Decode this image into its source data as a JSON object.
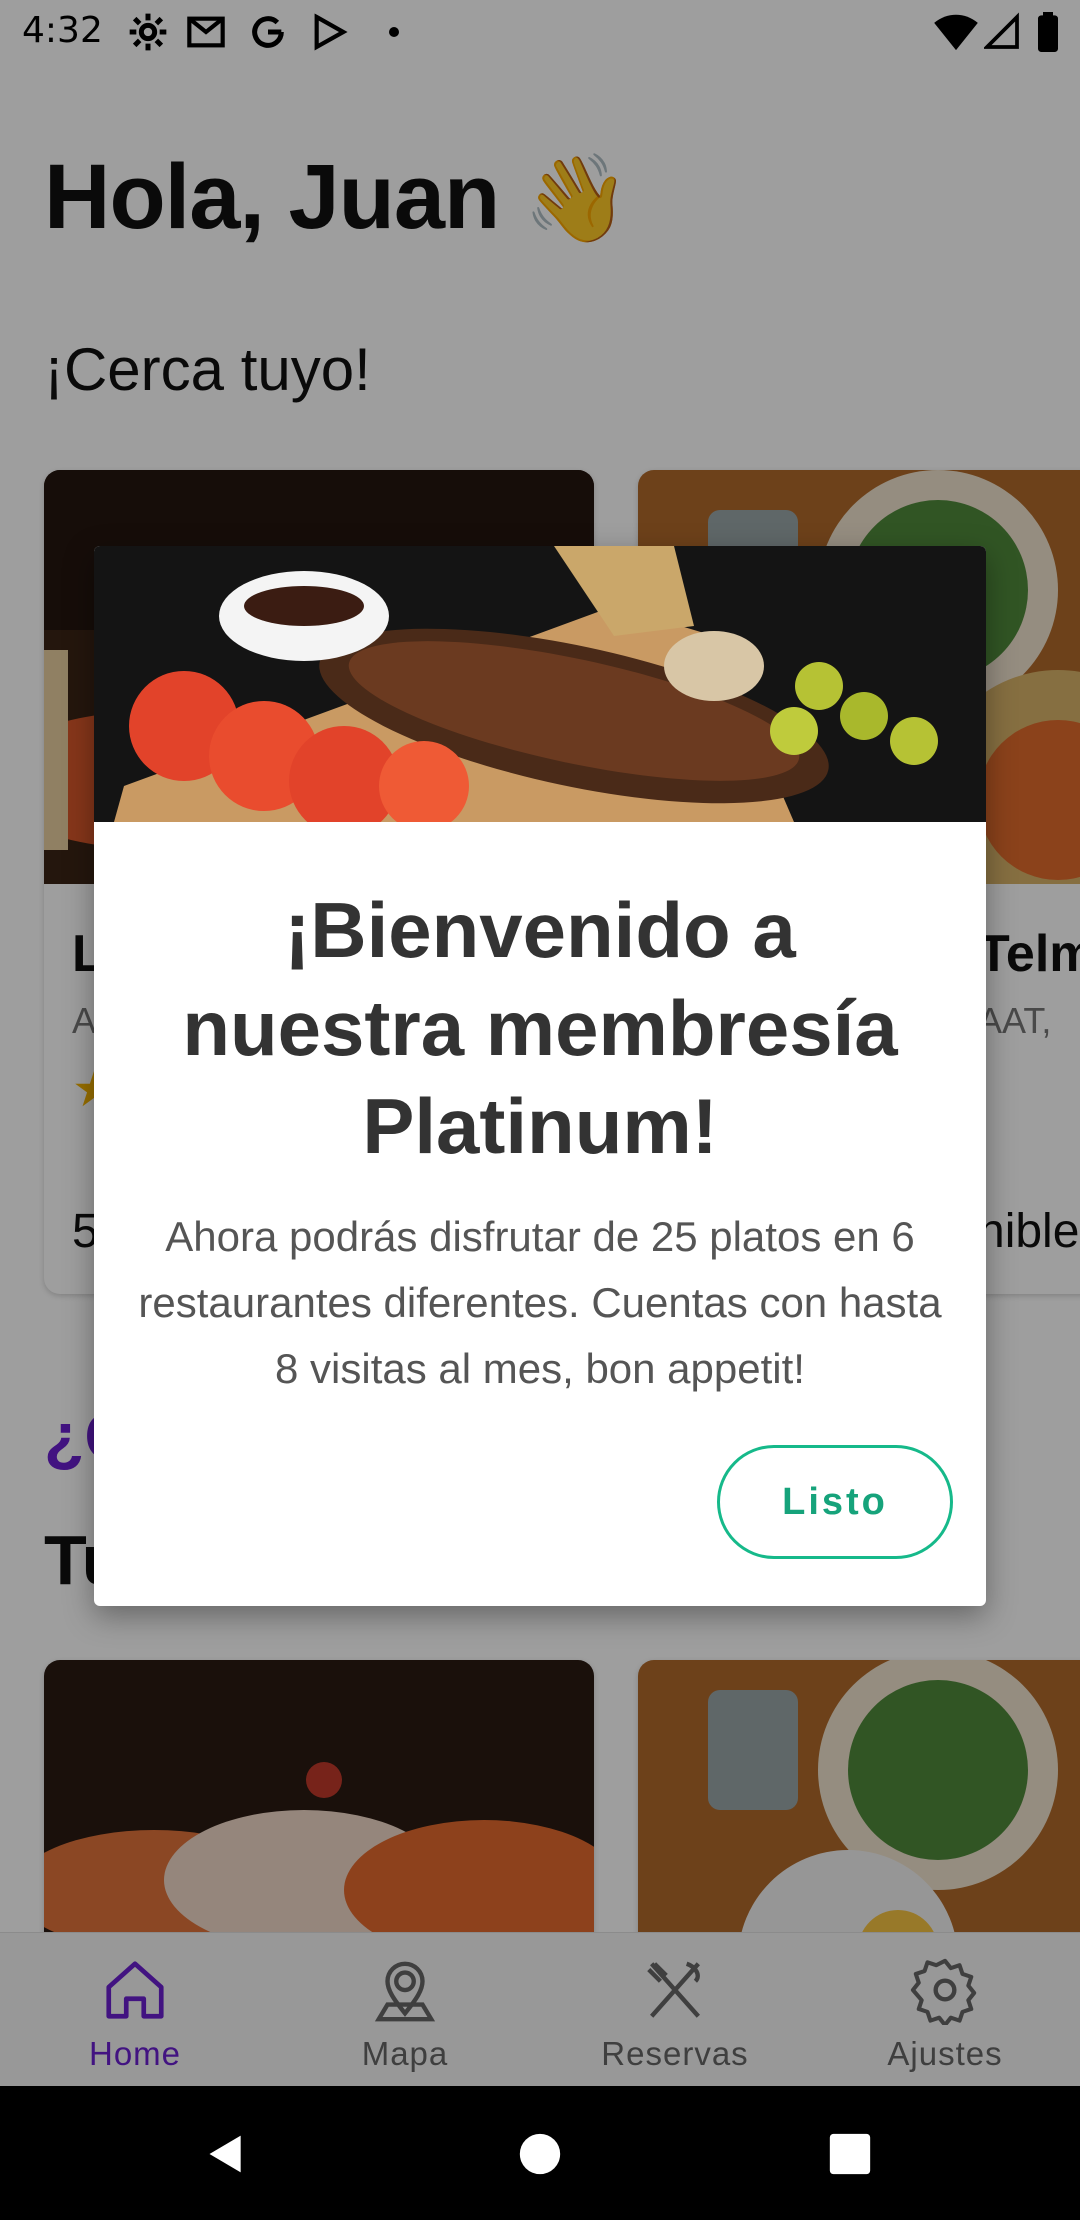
{
  "status_bar": {
    "time": "4:32"
  },
  "header": {
    "greeting": "Hola, Juan",
    "greeting_emoji": "👋"
  },
  "nearby": {
    "title": "¡Cerca tuyo!",
    "cards": [
      {
        "name": "L",
        "subtitle": "A",
        "rating_icon": "star-icon",
        "footer": "5"
      },
      {
        "name": "Telm",
        "subtitle": "AAT,",
        "footer": "nible"
      }
    ]
  },
  "promo_title": "¿C",
  "yours_title": "Tu",
  "bottom_nav": {
    "items": [
      {
        "label": "Home",
        "icon": "home-icon",
        "active": true
      },
      {
        "label": "Mapa",
        "icon": "map-pin-icon",
        "active": false
      },
      {
        "label": "Reservas",
        "icon": "fork-knife-icon",
        "active": false
      },
      {
        "label": "Ajustes",
        "icon": "gear-icon",
        "active": false
      }
    ]
  },
  "dialog": {
    "title": "¡Bienvenido a nuestra membresía Platinum!",
    "message": "Ahora podrás disfrutar de 25 platos en 6 restaurantes diferentes. Cuentas con hasta 8 visitas al mes, bon appetit!",
    "button_label": "Listo"
  },
  "colors": {
    "accent": "#6b1fd1",
    "button": "#16b98a",
    "scrim": "rgba(0,0,0,0.38)"
  }
}
